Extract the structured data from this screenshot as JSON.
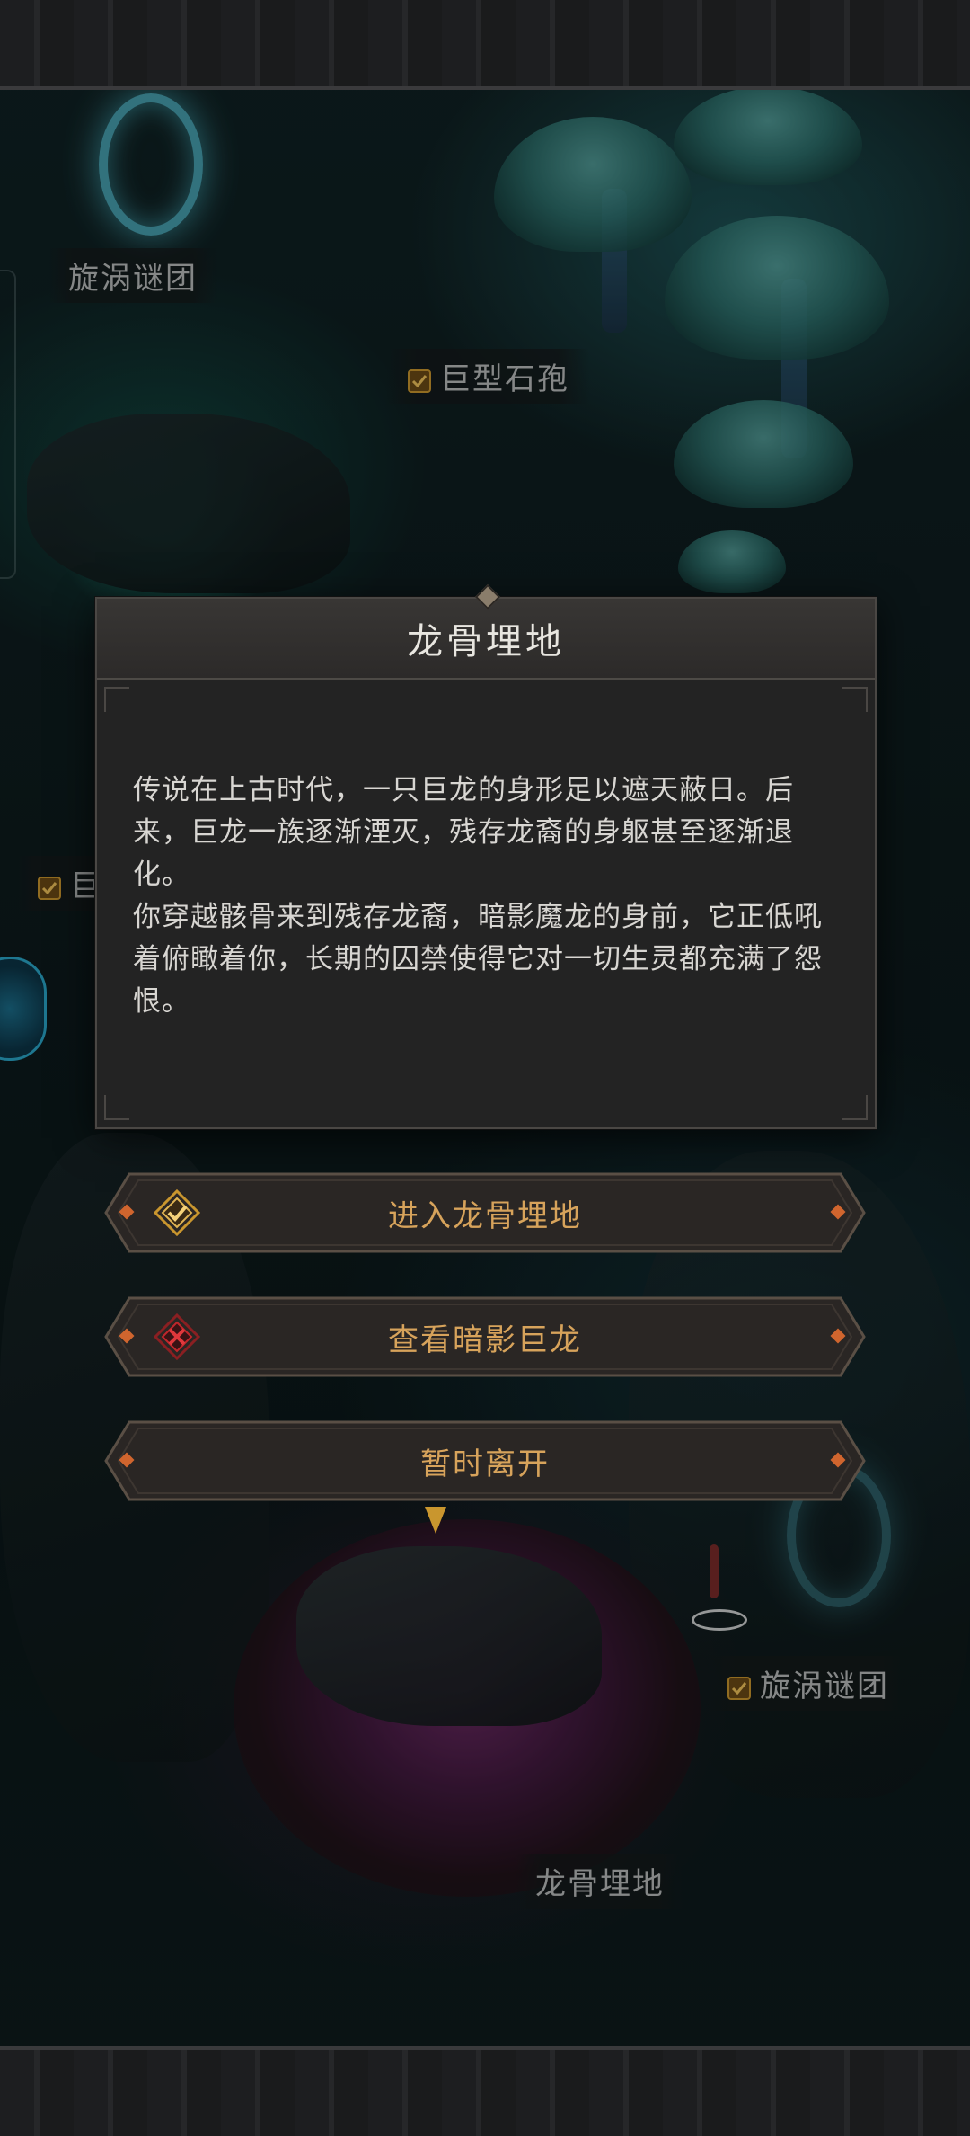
{
  "map": {
    "labels": {
      "vortex_top": "旋涡谜团",
      "giant_spore": "巨型石孢",
      "left_partial": "巨",
      "vortex_right": "旋涡谜团",
      "dragon_bone": "龙骨埋地"
    }
  },
  "dialog": {
    "title": "龙骨埋地",
    "paragraph_1": "传说在上古时代，一只巨龙的身形足以遮天蔽日。后来，巨龙一族逐渐湮灭，残存龙裔的身躯甚至逐渐退化。",
    "paragraph_2": "你穿越骸骨来到残存龙裔，暗影魔龙的身前，它正低吼着俯瞰着你，长期的囚禁使得它对一切生灵都充满了怨恨。"
  },
  "options": [
    {
      "label": "进入龙骨埋地",
      "icon": "gold-check-diamond-icon"
    },
    {
      "label": "查看暗影巨龙",
      "icon": "red-cross-diamond-icon"
    },
    {
      "label": "暂时离开",
      "icon": ""
    }
  ],
  "colors": {
    "option_text": "#d7a35b",
    "check_gold": "#c9962e",
    "cross_red": "#c2262b",
    "gem_orange": "#d0652e"
  }
}
